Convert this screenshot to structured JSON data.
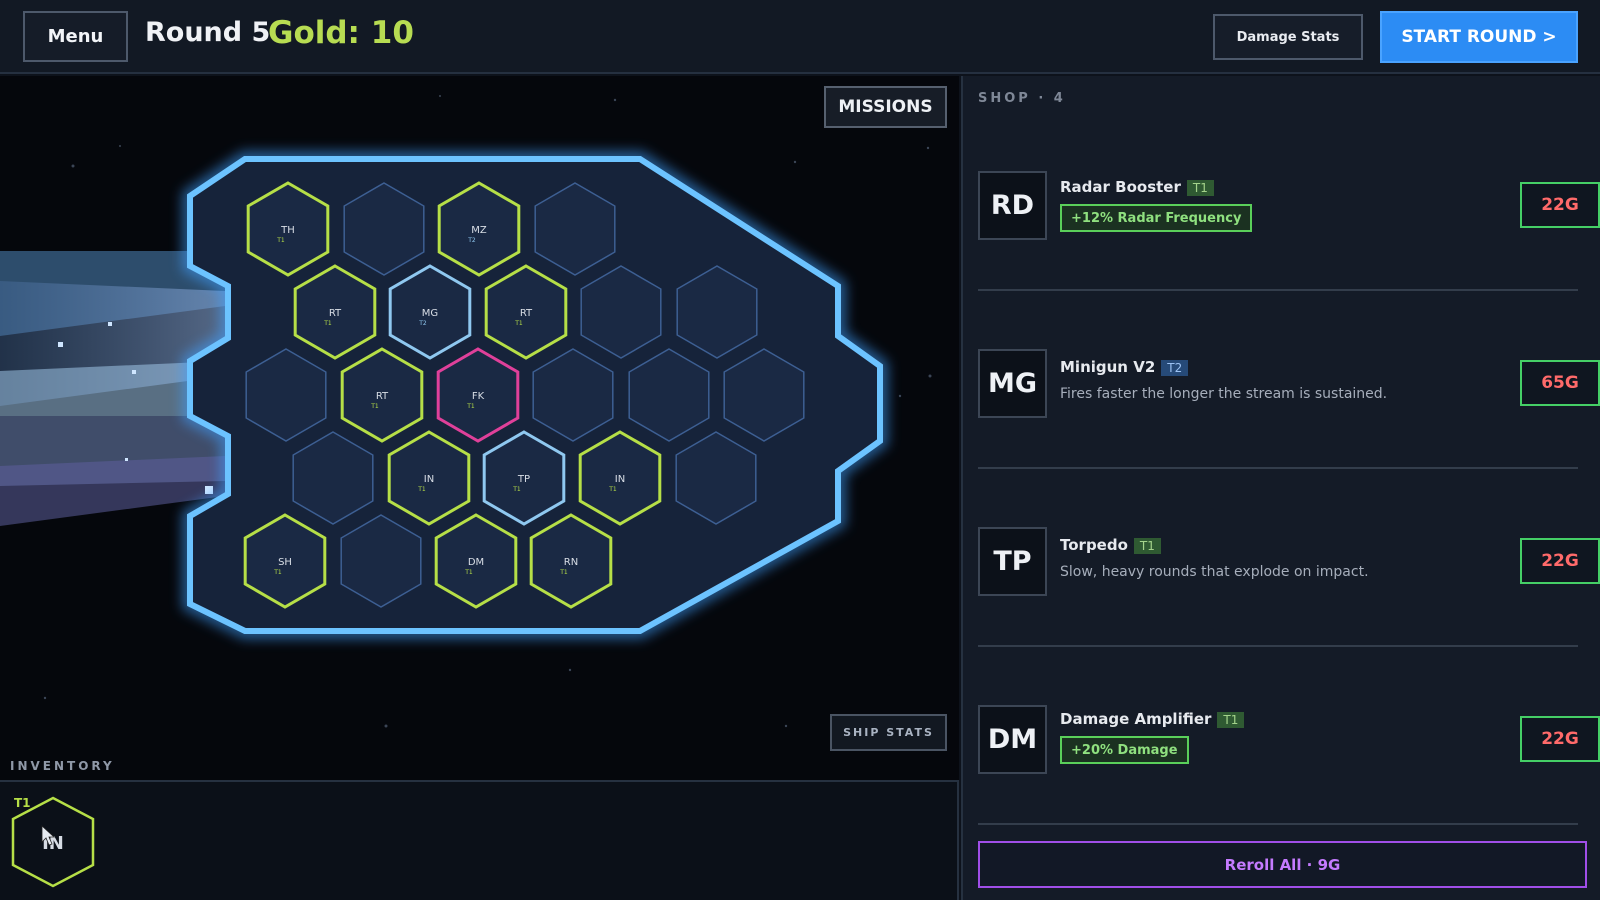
{
  "topbar": {
    "menu_label": "Menu",
    "round_label": "Round 5",
    "gold_label": "Gold: 10",
    "damage_stats_label": "Damage Stats",
    "start_round_label": "START ROUND >"
  },
  "board": {
    "missions_label": "MISSIONS",
    "ship_stats_label": "SHIP STATS",
    "modules": [
      {
        "code": "TH",
        "tier": "T1",
        "state": "equipped"
      },
      {
        "code": "MZ",
        "tier": "T2",
        "state": "equipped"
      },
      {
        "code": "RT",
        "tier": "T1",
        "state": "equipped"
      },
      {
        "code": "MG",
        "tier": "T2",
        "state": "core"
      },
      {
        "code": "RT",
        "tier": "T1",
        "state": "equipped"
      },
      {
        "code": "RT",
        "tier": "T1",
        "state": "equipped"
      },
      {
        "code": "FK",
        "tier": "T1",
        "state": "special"
      },
      {
        "code": "IN",
        "tier": "T1",
        "state": "equipped"
      },
      {
        "code": "TP",
        "tier": "T1",
        "state": "core"
      },
      {
        "code": "IN",
        "tier": "T1",
        "state": "equipped"
      },
      {
        "code": "SH",
        "tier": "T1",
        "state": "equipped"
      },
      {
        "code": "DM",
        "tier": "T1",
        "state": "equipped"
      },
      {
        "code": "RN",
        "tier": "T1",
        "state": "equipped"
      }
    ]
  },
  "inventory": {
    "label": "INVENTORY",
    "item": {
      "code": "IN",
      "tier": "T1"
    }
  },
  "shop": {
    "title": "SHOP · 4",
    "items": [
      {
        "code": "RD",
        "name": "Radar Booster",
        "tier": "T1",
        "bonus": "+12% Radar Frequency",
        "description": "",
        "price": "22G"
      },
      {
        "code": "MG",
        "name": "Minigun V2",
        "tier": "T2",
        "bonus": "",
        "description": "Fires faster the longer the stream is sustained.",
        "price": "65G"
      },
      {
        "code": "TP",
        "name": "Torpedo",
        "tier": "T1",
        "bonus": "",
        "description": "Slow, heavy rounds that explode on impact.",
        "price": "22G"
      },
      {
        "code": "DM",
        "name": "Damage Amplifier",
        "tier": "T1",
        "bonus": "+20% Damage",
        "description": "",
        "price": "22G"
      }
    ],
    "reroll_label": "Reroll All · 9G"
  },
  "colors": {
    "accent_blue": "#2c8cf4",
    "gold": "#b7dc52",
    "equipped": "#b6df47",
    "core": "#8fc8f0",
    "special": "#e0409a",
    "price_text": "#ff6a6a",
    "reroll": "#a04ee8"
  }
}
